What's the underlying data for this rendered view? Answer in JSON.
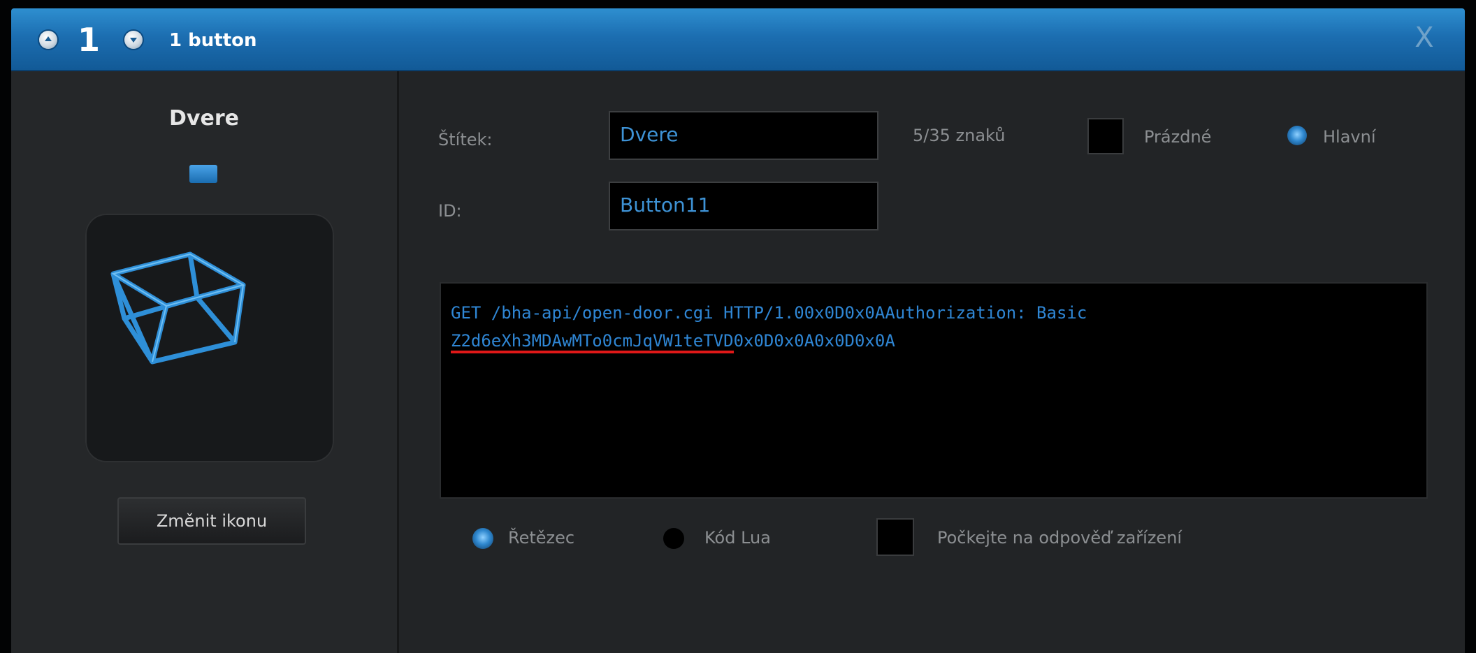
{
  "titlebar": {
    "index": "1",
    "title": "1 button",
    "close_glyph": "X",
    "icons": [
      "arrow-up-icon",
      "arrow-down-icon",
      "close-icon"
    ]
  },
  "device": {
    "name": "Dvere",
    "icon": "cube-icon",
    "change_icon_label": "Změnit ikonu"
  },
  "form": {
    "label_caption": "Štítek:",
    "label_value": "Dvere",
    "char_count": "5/35 znaků",
    "empty_label": "Prázdné",
    "main_label": "Hlavní",
    "id_caption": "ID:",
    "id_value": "Button11"
  },
  "command": {
    "line1": "GET /bha-api/open-door.cgi HTTP/1.00x0D0x0AAuthorization: Basic",
    "line2_token": "Z2d6eXh3MDAwMTo0cmJqVW1teTVD",
    "line2_rest": "0x0D0x0A0x0D0x0A"
  },
  "mode": {
    "string_label": "Řetězec",
    "lua_label": "Kód Lua",
    "wait_label": "Počkejte na odpověď zařízení",
    "selected": "string"
  },
  "colors": {
    "accent": "#2f86d4",
    "titlebar": "#1c6eb1",
    "highlight_underline": "#e01818"
  }
}
